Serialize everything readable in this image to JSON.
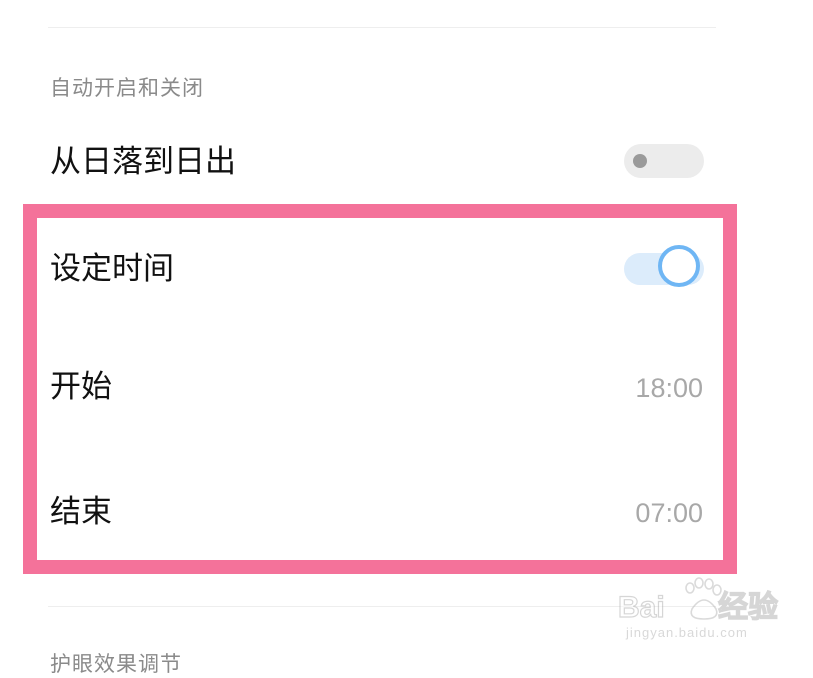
{
  "settings": {
    "section_auto_title": "自动开启和关闭",
    "sunset_label": "从日落到日出",
    "sunset_toggle_state": "off",
    "schedule_label": "设定时间",
    "schedule_toggle_state": "on",
    "start_label": "开始",
    "start_value": "18:00",
    "end_label": "结束",
    "end_value": "07:00",
    "section_effect_title": "护眼效果调节"
  },
  "overlay": {
    "highlight_color": "#f4729a"
  },
  "watermark": {
    "brand": "Baidu经验",
    "url": "jingyan.baidu.com"
  },
  "colors": {
    "toggle_on_track": "#dcecfb",
    "toggle_on_knob_border": "#6fb6f4",
    "toggle_off_track": "#ececec"
  }
}
